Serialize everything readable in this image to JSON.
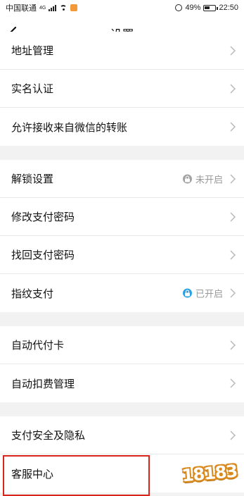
{
  "status_bar": {
    "carrier": "中国联通",
    "network": "4G",
    "battery": "49%",
    "time": "22:50"
  },
  "nav": {
    "title": "设置"
  },
  "groups": [
    {
      "items": [
        {
          "label": "地址管理"
        },
        {
          "label": "实名认证"
        },
        {
          "label": "允许接收来自微信的转账"
        }
      ]
    },
    {
      "items": [
        {
          "label": "解锁设置",
          "status": "未开启",
          "status_on": false
        },
        {
          "label": "修改支付密码"
        },
        {
          "label": "找回支付密码"
        },
        {
          "label": "指纹支付",
          "status": "已开启",
          "status_on": true
        }
      ]
    },
    {
      "items": [
        {
          "label": "自动代付卡"
        },
        {
          "label": "自动扣费管理"
        }
      ]
    },
    {
      "items": [
        {
          "label": "支付安全及隐私"
        },
        {
          "label": "客服中心"
        }
      ]
    }
  ],
  "watermark": "18183",
  "colors": {
    "accent_on": "#2aa1e6",
    "status_off": "#a3a3a3",
    "highlight": "#d9241b"
  }
}
